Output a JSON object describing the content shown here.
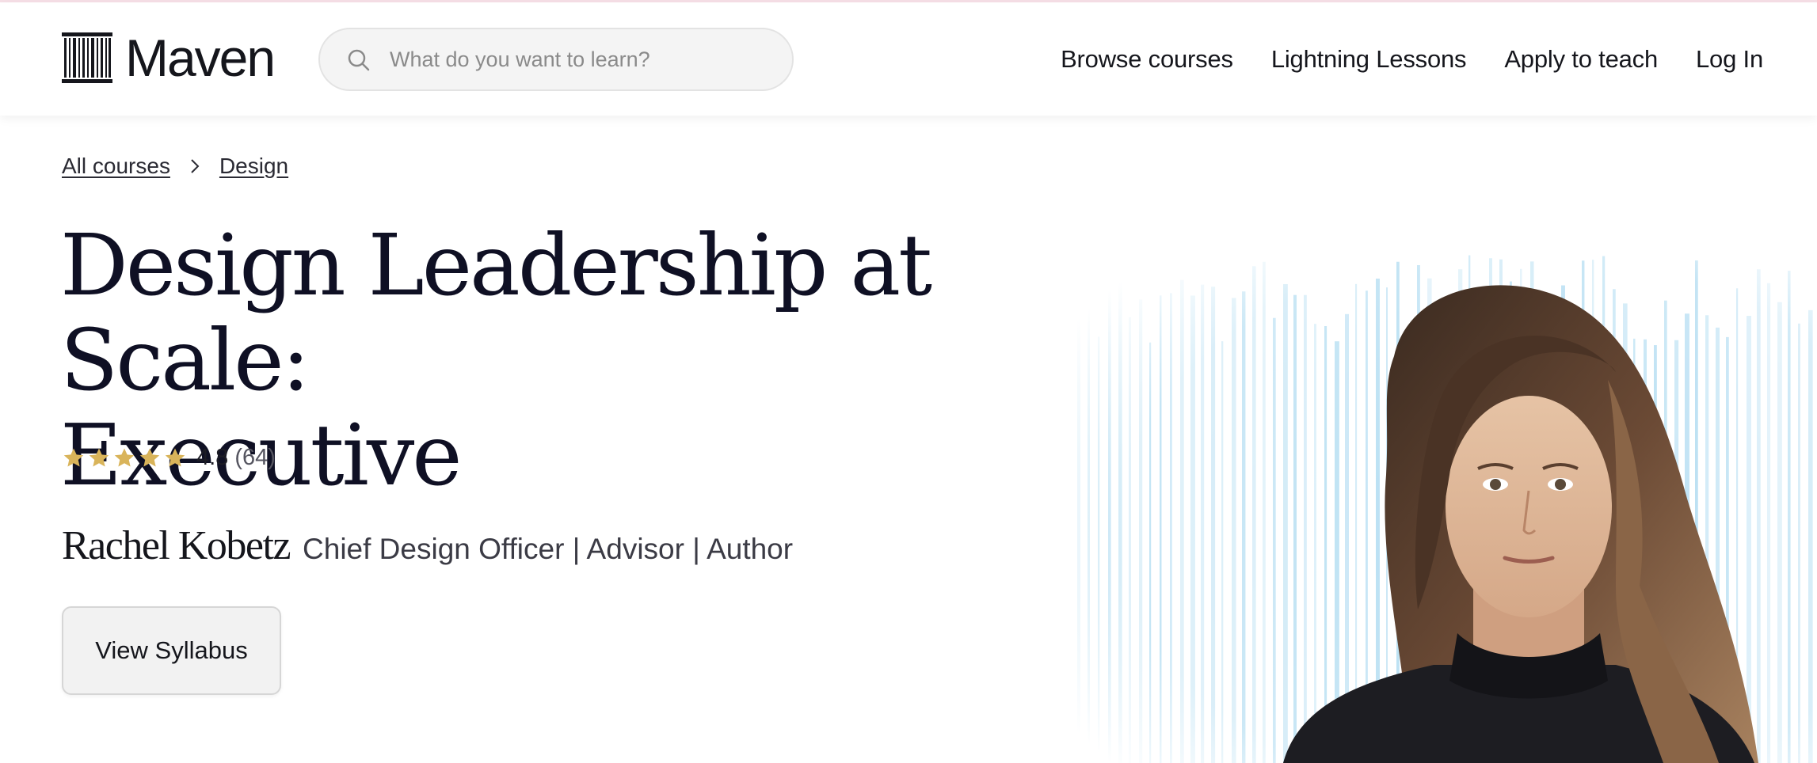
{
  "header": {
    "logo_text": "Maven",
    "search": {
      "placeholder": "What do you want to learn?",
      "value": ""
    },
    "nav": [
      "Browse courses",
      "Lightning Lessons",
      "Apply to teach",
      "Log In"
    ]
  },
  "breadcrumb": [
    "All courses",
    "Design"
  ],
  "course": {
    "title_line1": "Design Leadership at Scale:",
    "title_line2": "Executive",
    "rating": {
      "stars": 5,
      "value": "4.8",
      "count": "(64)"
    },
    "instructor_name": "Rachel Kobetz",
    "instructor_role": "Chief Design Officer | Advisor | Author",
    "cta_label": "View Syllabus"
  },
  "icons": {
    "logo": "columns-logo-icon",
    "search": "search-icon",
    "breadcrumb_sep": "chevron-right-icon",
    "star": "star-icon"
  },
  "colors": {
    "star": "#d9b45a",
    "title": "#0f1024",
    "hero_stripes": "#a8d8f0",
    "top_accent": "#f6dfe6"
  }
}
